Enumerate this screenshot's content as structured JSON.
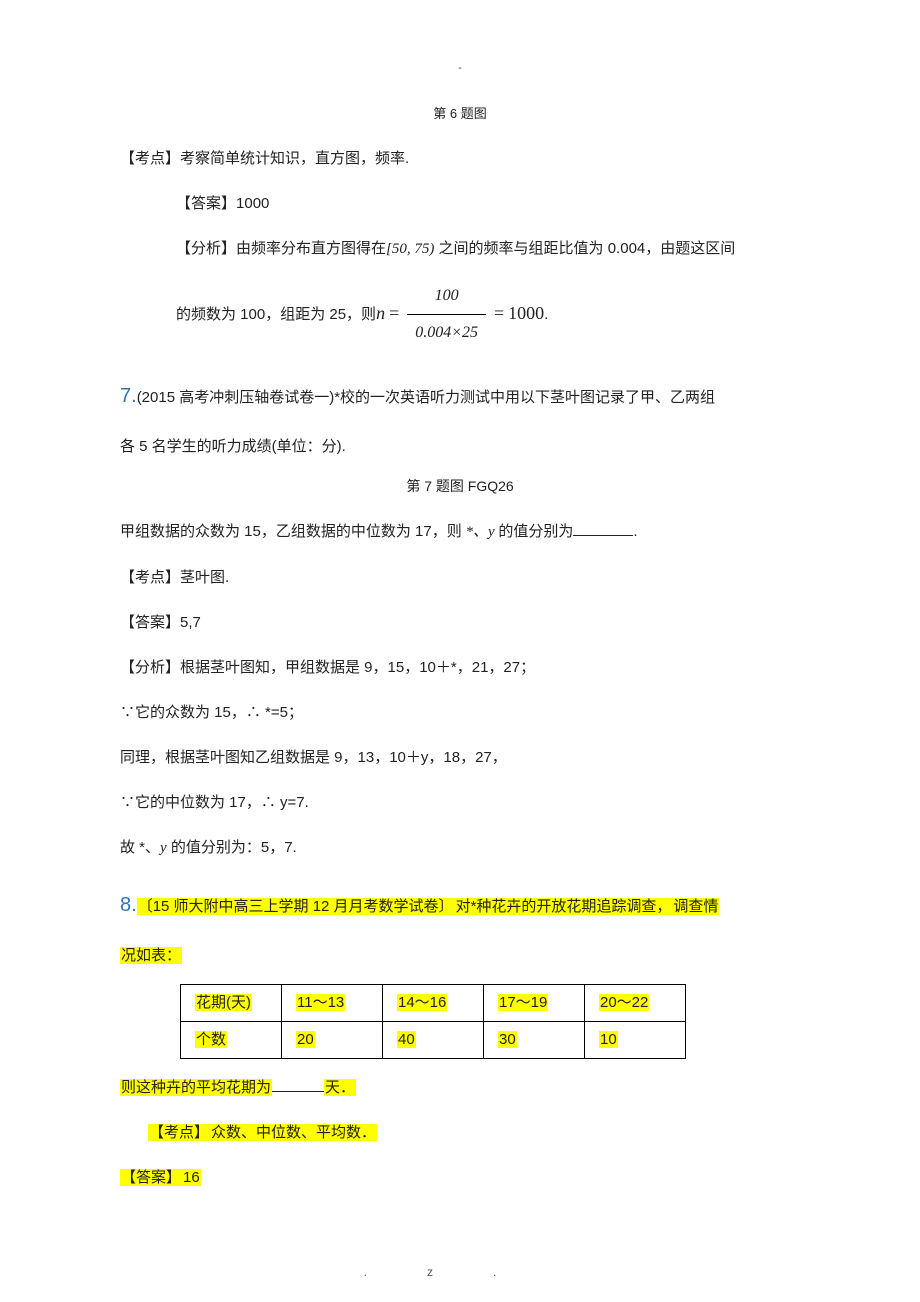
{
  "header": {
    "marker": "-"
  },
  "q6": {
    "caption": "第 6 题图",
    "kaodian_label": "【考点】",
    "kaodian_text": "考察简单统计知识，直方图，频率.",
    "ans_label": "【答案】",
    "ans_text": "1000",
    "fenxi_label": "【分析】",
    "fenxi_text_a": "由频率分布直方图得在",
    "interval": "[50, 75)",
    "fenxi_text_b": "之间的频率与组距比值为 0.004，由题这区间",
    "fenxi_text_c": "的频数为 100，组距为 25，则",
    "formula_lhs": "n",
    "frac_num": "100",
    "frac_den": "0.004×25",
    "formula_result": "1000"
  },
  "q7": {
    "num": "7.",
    "source": "(2015 高考冲刺压轴卷试卷一)",
    "q_a": "*校的一次英语听力测试中用以下茎叶图记录了甲、乙两组",
    "q_b": "各 5 名学生的听力成绩(单位：分).",
    "caption": "第 7 题图  FGQ26",
    "q_c1": "甲组数据的众数为 15，乙组数据的中位数为 17，则",
    "xy": " *、y ",
    "q_c2": "的值分别为",
    "kaodian_label": "【考点】",
    "kaodian_text": "茎叶图.",
    "ans_label": "【答案】",
    "ans_text": "5,7",
    "fenxi_label": "【分析】",
    "fenxi_l1": "根据茎叶图知，甲组数据是 9，15，10＋*，21，27；",
    "fenxi_l2": "∵它的众数为 15，∴ *=5；",
    "fenxi_l3": "同理，根据茎叶图知乙组数据是 9，13，10＋y，18，27，",
    "fenxi_l4": "∵它的中位数为 17，∴ y=7.",
    "fenxi_l5a": "故 *、",
    "fenxi_l5b": "y",
    "fenxi_l5c": " 的值分别为：5，7."
  },
  "q8": {
    "num": "8.",
    "source": "〔15 师大附中高三上学期 12 月月考数学试卷〕",
    "q_a": "对*种花卉的开放花期追踪调查，",
    "q_b": "调查情",
    "q_c": "况如表：",
    "table": {
      "r1c1": "花期(天)",
      "r1c2": "11～13",
      "r1c3": "14～16",
      "r1c4": "17～19",
      "r1c5": "20～22",
      "r2c1": "个数",
      "r2c2": "20",
      "r2c3": "40",
      "r2c4": "30",
      "r2c5": "10"
    },
    "concl_a": "则这种卉的平均花期为",
    "concl_b": "天．",
    "kaodian_label": "【考点】",
    "kaodian_text": "众数、中位数、平均数．",
    "ans_label": "【答案】",
    "ans_text": "16"
  },
  "footer": {
    "left": ".",
    "right": "z."
  }
}
